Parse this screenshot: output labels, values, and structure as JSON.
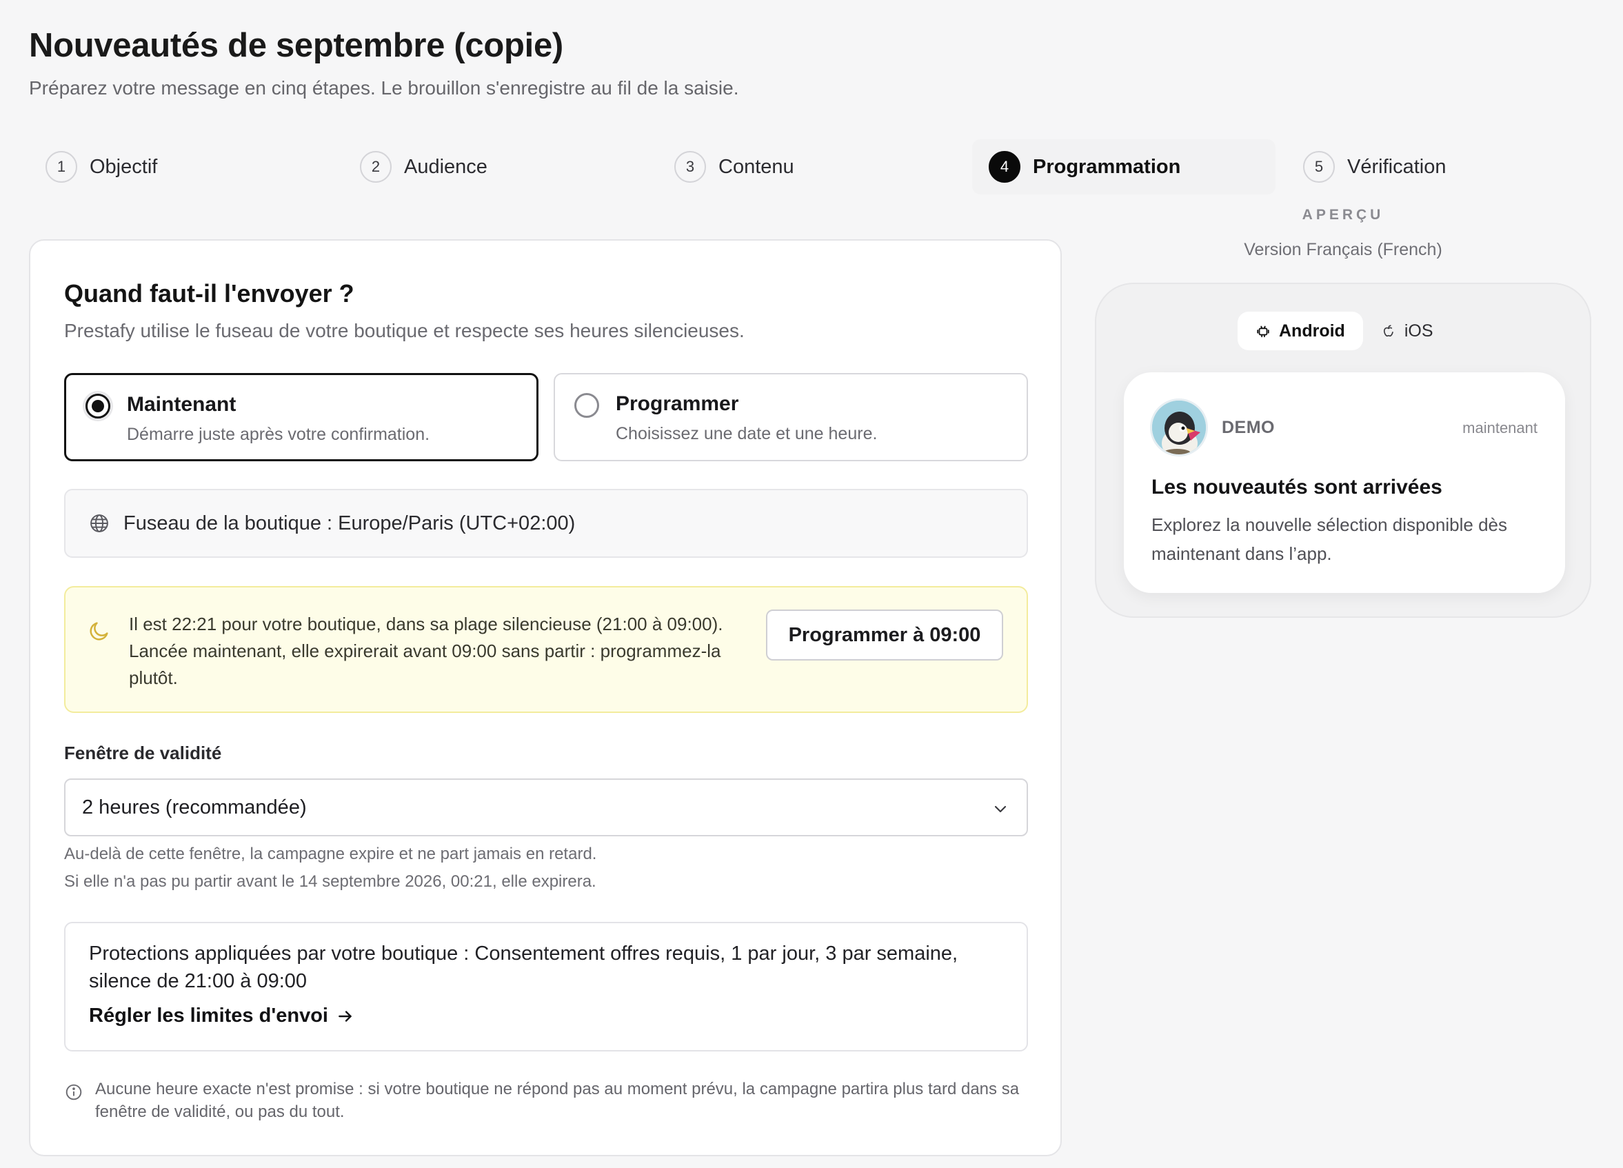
{
  "page": {
    "title": "Nouveautés de septembre (copie)",
    "subtitle": "Préparez votre message en cinq étapes. Le brouillon s'enregistre au fil de la saisie."
  },
  "stepper": {
    "active_step": 4,
    "steps": [
      {
        "num": "1",
        "label": "Objectif"
      },
      {
        "num": "2",
        "label": "Audience"
      },
      {
        "num": "3",
        "label": "Contenu"
      },
      {
        "num": "4",
        "label": "Programmation"
      },
      {
        "num": "5",
        "label": "Vérification"
      }
    ]
  },
  "schedule": {
    "title": "Quand faut-il l'envoyer ?",
    "subtitle": "Prestafy utilise le fuseau de votre boutique et respecte ses heures silencieuses.",
    "options": [
      {
        "title": "Maintenant",
        "description": "Démarre juste après votre confirmation.",
        "selected": true
      },
      {
        "title": "Programmer",
        "description": "Choisissez une date et une heure.",
        "selected": false
      }
    ],
    "timezone_text": "Fuseau de la boutique : Europe/Paris (UTC+02:00)",
    "quiet_warning": {
      "text": "Il est 22:21 pour votre boutique, dans sa plage silencieuse (21:00 à 09:00). Lancée maintenant, elle expirerait avant 09:00 sans partir : programmez-la plutôt.",
      "button_label": "Programmer à 09:00"
    },
    "validity": {
      "label": "Fenêtre de validité",
      "selected_value": "2 heures (recommandée)",
      "help_line1": "Au-delà de cette fenêtre, la campagne expire et ne part jamais en retard.",
      "help_line2": "Si elle n'a pas pu partir avant le 14 septembre 2026, 00:21, elle expirera."
    },
    "protections": {
      "text": "Protections appliquées par votre boutique : Consentement offres requis, 1 par jour, 3 par semaine, silence de 21:00 à 09:00",
      "link_label": "Régler les limites d'envoi"
    },
    "note": "Aucune heure exacte n'est promise : si votre boutique ne répond pas au moment prévu, la campagne partira plus tard dans sa fenêtre de validité, ou pas du tout."
  },
  "preview": {
    "label": "APERÇU",
    "language": "Version Français (French)",
    "os_tabs": [
      {
        "label": "Android",
        "icon": "android-icon",
        "active": true
      },
      {
        "label": "iOS",
        "icon": "apple-icon",
        "active": false
      }
    ],
    "notification": {
      "app_name": "DEMO",
      "time": "maintenant",
      "title": "Les nouveautés sont arrivées",
      "body": "Explorez la nouvelle sélection disponible dès maintenant dans l’app."
    }
  },
  "colors": {
    "accent": "#0a0a0a",
    "warning_bg": "#fefde8",
    "warning_border": "#f3ec9d",
    "moon_icon": "#d4b23a"
  }
}
